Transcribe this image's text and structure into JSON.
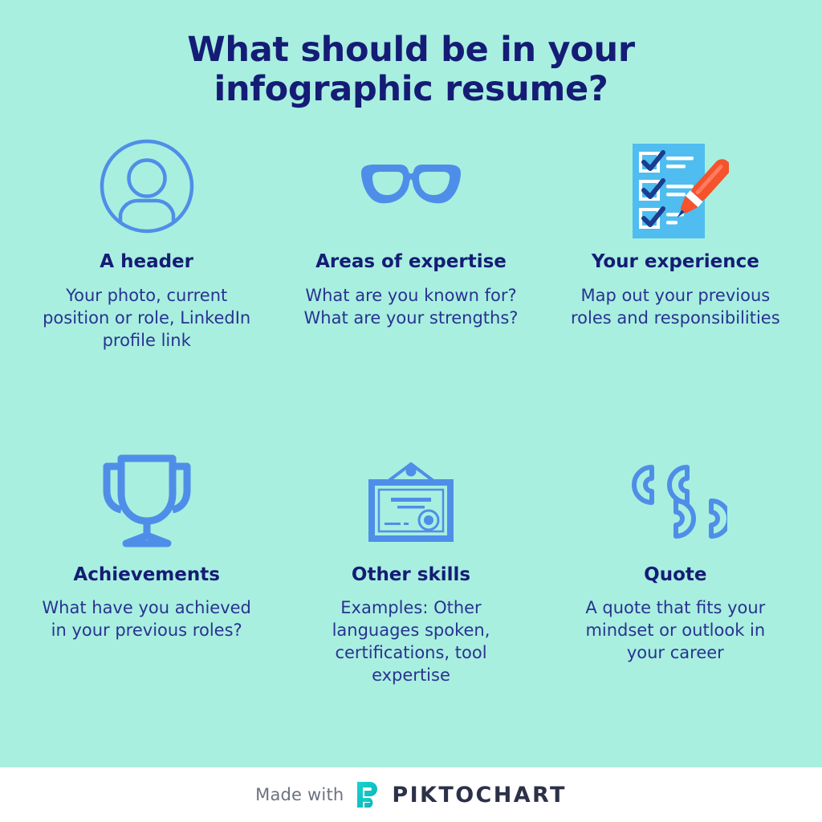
{
  "header": {
    "title": "What should be in your infographic resume?"
  },
  "colors": {
    "background": "#A8EFE0",
    "title_text": "#151C75",
    "body_text": "#2A3290",
    "icon_blue": "#4F8EE8",
    "icon_light_blue": "#4FBDEF",
    "pencil_red": "#F4532B",
    "logo_teal": "#12C2C0",
    "brand_dark": "#2B3147",
    "footer_background": "#FFFFFF"
  },
  "cards": [
    {
      "icon": "user-avatar-icon",
      "title": "A header",
      "body": "Your photo, current position or role, LinkedIn profile link"
    },
    {
      "icon": "glasses-icon",
      "title": "Areas of expertise",
      "body": "What are you known for? What are your strengths?"
    },
    {
      "icon": "checklist-pencil-icon",
      "title": "Your experience",
      "body": "Map out your previous roles and responsibilities"
    },
    {
      "icon": "trophy-icon",
      "title": "Achievements",
      "body": "What have you achieved in your previous roles?"
    },
    {
      "icon": "certificate-icon",
      "title": "Other skills",
      "body": "Examples: Other languages spoken, certifications, tool expertise"
    },
    {
      "icon": "quotation-marks-icon",
      "title": "Quote",
      "body": "A quote that fits your mindset or outlook in your career"
    }
  ],
  "footer": {
    "made_with": "Made with",
    "brand": "PIKTOCHART",
    "logo_icon": "piktochart-p-logo-icon"
  }
}
